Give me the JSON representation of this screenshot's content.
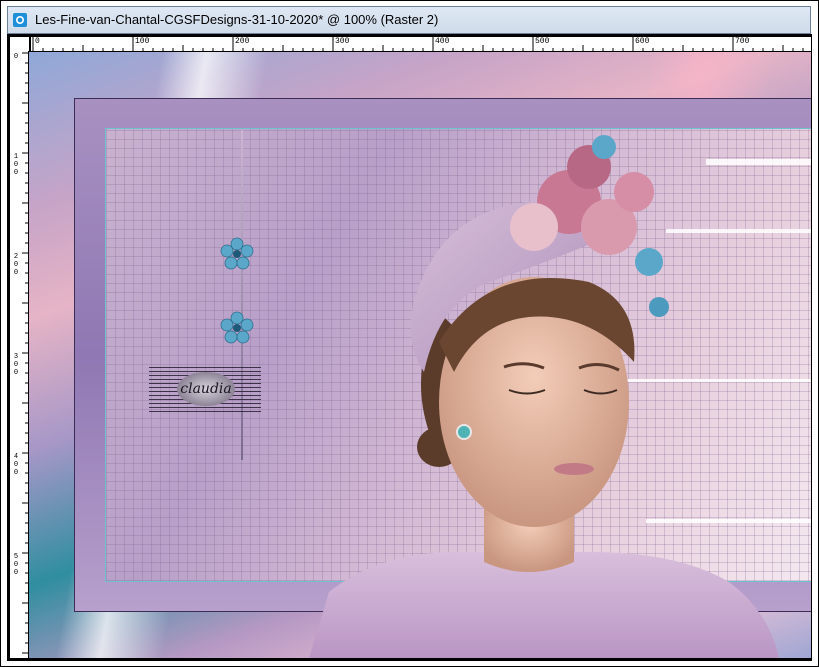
{
  "window": {
    "title": "Les-Fine-van-Chantal-CGSFDesigns-31-10-2020* @ 100% (Raster 2)"
  },
  "ruler": {
    "top_labels": [
      "0",
      "100",
      "200",
      "300",
      "400",
      "500",
      "600",
      "700"
    ],
    "left_labels": [
      "0",
      "100",
      "200",
      "300",
      "400",
      "500"
    ]
  },
  "artwork": {
    "watermark_text": "claudia",
    "colors": {
      "lavender": "#b79fc8",
      "teal": "#2f8ea0",
      "pink": "#e6b4c6",
      "flower_blue": "#5aa7c9"
    }
  }
}
